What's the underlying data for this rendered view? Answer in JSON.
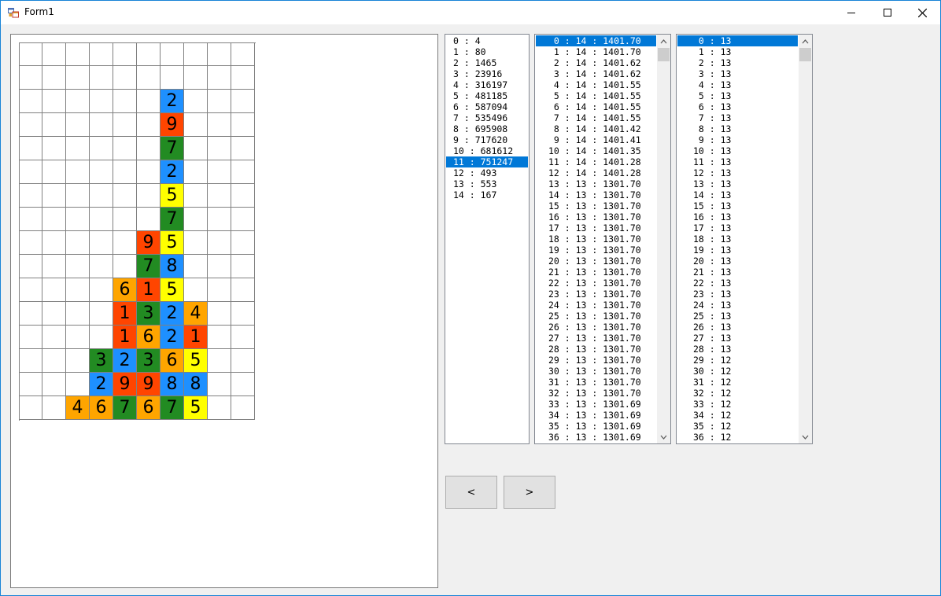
{
  "window": {
    "title": "Form1",
    "icons": {
      "app": "form-app-icon",
      "minimize": "minimize-icon",
      "maximize": "maximize-icon",
      "close": "close-icon"
    }
  },
  "puzzle_grid": {
    "columns": 10,
    "rows": 16,
    "colors": {
      "1": "#ff4500",
      "2": "#1e90ff",
      "3": "#228b22",
      "4": "#ffa500",
      "5": "#ffff00",
      "6": "#ffa500",
      "7": "#228b22",
      "8": "#1e90ff",
      "9": "#ff4500"
    },
    "cells": [
      {
        "r": 2,
        "c": 6,
        "v": "2"
      },
      {
        "r": 3,
        "c": 6,
        "v": "9"
      },
      {
        "r": 4,
        "c": 6,
        "v": "7"
      },
      {
        "r": 5,
        "c": 6,
        "v": "2"
      },
      {
        "r": 6,
        "c": 6,
        "v": "5"
      },
      {
        "r": 7,
        "c": 6,
        "v": "7"
      },
      {
        "r": 8,
        "c": 5,
        "v": "9"
      },
      {
        "r": 8,
        "c": 6,
        "v": "5"
      },
      {
        "r": 9,
        "c": 5,
        "v": "7"
      },
      {
        "r": 9,
        "c": 6,
        "v": "8"
      },
      {
        "r": 10,
        "c": 4,
        "v": "6"
      },
      {
        "r": 10,
        "c": 5,
        "v": "1"
      },
      {
        "r": 10,
        "c": 6,
        "v": "5"
      },
      {
        "r": 11,
        "c": 4,
        "v": "1"
      },
      {
        "r": 11,
        "c": 5,
        "v": "3"
      },
      {
        "r": 11,
        "c": 6,
        "v": "2"
      },
      {
        "r": 11,
        "c": 7,
        "v": "4"
      },
      {
        "r": 12,
        "c": 4,
        "v": "1"
      },
      {
        "r": 12,
        "c": 5,
        "v": "6"
      },
      {
        "r": 12,
        "c": 6,
        "v": "2"
      },
      {
        "r": 12,
        "c": 7,
        "v": "1"
      },
      {
        "r": 13,
        "c": 3,
        "v": "3"
      },
      {
        "r": 13,
        "c": 4,
        "v": "2"
      },
      {
        "r": 13,
        "c": 5,
        "v": "3"
      },
      {
        "r": 13,
        "c": 6,
        "v": "6"
      },
      {
        "r": 13,
        "c": 7,
        "v": "5"
      },
      {
        "r": 14,
        "c": 3,
        "v": "2"
      },
      {
        "r": 14,
        "c": 4,
        "v": "9"
      },
      {
        "r": 14,
        "c": 5,
        "v": "9"
      },
      {
        "r": 14,
        "c": 6,
        "v": "8"
      },
      {
        "r": 14,
        "c": 7,
        "v": "8"
      },
      {
        "r": 15,
        "c": 2,
        "v": "4"
      },
      {
        "r": 15,
        "c": 3,
        "v": "6"
      },
      {
        "r": 15,
        "c": 4,
        "v": "7"
      },
      {
        "r": 15,
        "c": 5,
        "v": "6"
      },
      {
        "r": 15,
        "c": 6,
        "v": "7"
      },
      {
        "r": 15,
        "c": 7,
        "v": "5"
      }
    ]
  },
  "list1": {
    "selected_index": 11,
    "items": [
      "0 : 4",
      "1 : 80",
      "2 : 1465",
      "3 : 23916",
      "4 : 316197",
      "5 : 481185",
      "6 : 587094",
      "7 : 535496",
      "8 : 695908",
      "9 : 717620",
      "10 : 681612",
      "11 : 751247",
      "12 : 493",
      "13 : 553",
      "14 : 167"
    ]
  },
  "list2": {
    "selected_index": 0,
    "scroll_fraction": 0.0,
    "items": [
      " 0 : 14 : 1401.70",
      " 1 : 14 : 1401.70",
      " 2 : 14 : 1401.62",
      " 3 : 14 : 1401.62",
      " 4 : 14 : 1401.55",
      " 5 : 14 : 1401.55",
      " 6 : 14 : 1401.55",
      " 7 : 14 : 1401.55",
      " 8 : 14 : 1401.42",
      " 9 : 14 : 1401.41",
      "10 : 14 : 1401.35",
      "11 : 14 : 1401.28",
      "12 : 14 : 1401.28",
      "13 : 13 : 1301.70",
      "14 : 13 : 1301.70",
      "15 : 13 : 1301.70",
      "16 : 13 : 1301.70",
      "17 : 13 : 1301.70",
      "18 : 13 : 1301.70",
      "19 : 13 : 1301.70",
      "20 : 13 : 1301.70",
      "21 : 13 : 1301.70",
      "22 : 13 : 1301.70",
      "23 : 13 : 1301.70",
      "24 : 13 : 1301.70",
      "25 : 13 : 1301.70",
      "26 : 13 : 1301.70",
      "27 : 13 : 1301.70",
      "28 : 13 : 1301.70",
      "29 : 13 : 1301.70",
      "30 : 13 : 1301.70",
      "31 : 13 : 1301.70",
      "32 : 13 : 1301.70",
      "33 : 13 : 1301.69",
      "34 : 13 : 1301.69",
      "35 : 13 : 1301.69",
      "36 : 13 : 1301.69"
    ]
  },
  "list3": {
    "selected_index": 0,
    "scroll_fraction": 0.0,
    "items": [
      " 0 : 13",
      " 1 : 13",
      " 2 : 13",
      " 3 : 13",
      " 4 : 13",
      " 5 : 13",
      " 6 : 13",
      " 7 : 13",
      " 8 : 13",
      " 9 : 13",
      "10 : 13",
      "11 : 13",
      "12 : 13",
      "13 : 13",
      "14 : 13",
      "15 : 13",
      "16 : 13",
      "17 : 13",
      "18 : 13",
      "19 : 13",
      "20 : 13",
      "21 : 13",
      "22 : 13",
      "23 : 13",
      "24 : 13",
      "25 : 13",
      "26 : 13",
      "27 : 13",
      "28 : 13",
      "29 : 12",
      "30 : 12",
      "31 : 12",
      "32 : 12",
      "33 : 12",
      "34 : 12",
      "35 : 12",
      "36 : 12"
    ]
  },
  "buttons": {
    "prev_label": "<",
    "next_label": ">"
  }
}
